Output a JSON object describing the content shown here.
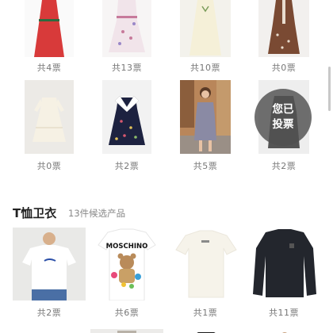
{
  "dresses": {
    "row1_counts": [
      "共4票",
      "共13票",
      "共10票",
      "共0票"
    ],
    "row2_counts": [
      "共0票",
      "共2票",
      "共5票",
      "共2票"
    ],
    "voted_badge": {
      "line1": "您已",
      "line2": "投票"
    }
  },
  "tshirts": {
    "title": "T恤卫衣",
    "subtitle": "13件候选产品",
    "counts": [
      "共2票",
      "共6票",
      "共1票",
      "共11票"
    ],
    "brand_text": "MOSCHINO"
  },
  "colors": {
    "badge_bg": "#505050",
    "count_text": "#777777"
  }
}
